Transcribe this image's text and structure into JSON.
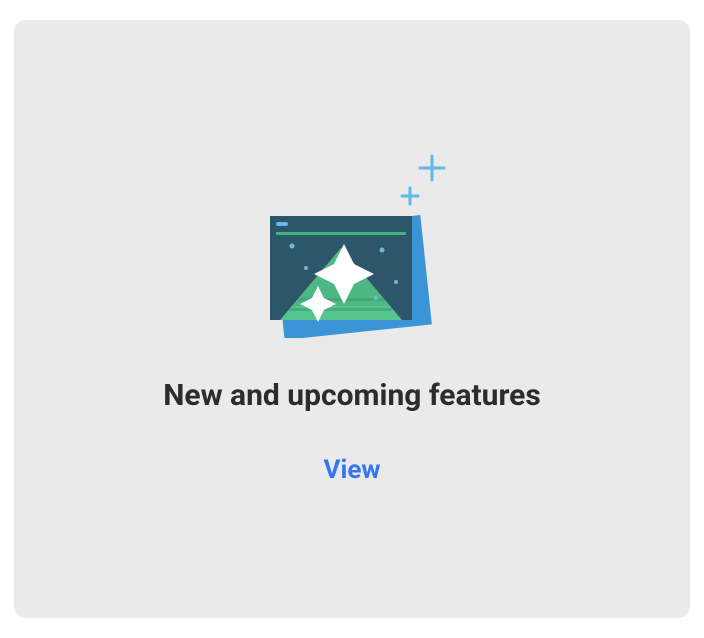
{
  "card": {
    "title": "New and upcoming features",
    "action_label": "View"
  }
}
